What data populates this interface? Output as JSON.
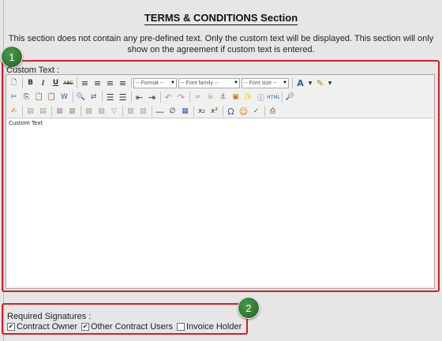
{
  "page": {
    "title": "TERMS & CONDITIONS Section",
    "description": "This section does not contain any pre-defined text. Only the custom text will be displayed. This section will only show on the agreement if custom text is entered."
  },
  "callouts": {
    "one": "1",
    "two": "2"
  },
  "editor": {
    "label": "Custom Text :",
    "content": "Custom Text",
    "format_placeholder": "-- Format --",
    "font_family_placeholder": "-- Font family --",
    "font_size_placeholder": "-- Font size --",
    "toolbar_row1": [
      "new-document",
      "bold",
      "italic",
      "underline",
      "strikethrough",
      "align-left",
      "align-center",
      "align-right",
      "align-justify",
      "font-color",
      "highlight-color"
    ],
    "toolbar_row2": [
      "cut",
      "copy",
      "paste",
      "paste-text",
      "paste-word",
      "find",
      "replace",
      "bullet-list",
      "numbered-list",
      "outdent",
      "indent",
      "undo",
      "redo",
      "link",
      "unlink",
      "anchor",
      "image",
      "cleanup",
      "help",
      "html-source",
      "preview"
    ],
    "toolbar_row3": [
      "edit-css",
      "insert-row-before",
      "insert-row-after",
      "table",
      "cell-props",
      "row-props",
      "split-cells",
      "merge-cells",
      "horizontal-rule",
      "remove-format",
      "visual-aid",
      "subscript",
      "superscript",
      "special-char",
      "emoticon",
      "spellcheck",
      "print"
    ]
  },
  "signatures": {
    "label": "Required Signatures :",
    "options": [
      {
        "label": "Contract Owner",
        "checked": true
      },
      {
        "label": "Other Contract Users",
        "checked": true
      },
      {
        "label": "Invoice Holder",
        "checked": false
      }
    ]
  },
  "colors": {
    "highlight_border": "#d41f26",
    "badge": "#2d6e2d",
    "background": "#e6e6e6"
  }
}
